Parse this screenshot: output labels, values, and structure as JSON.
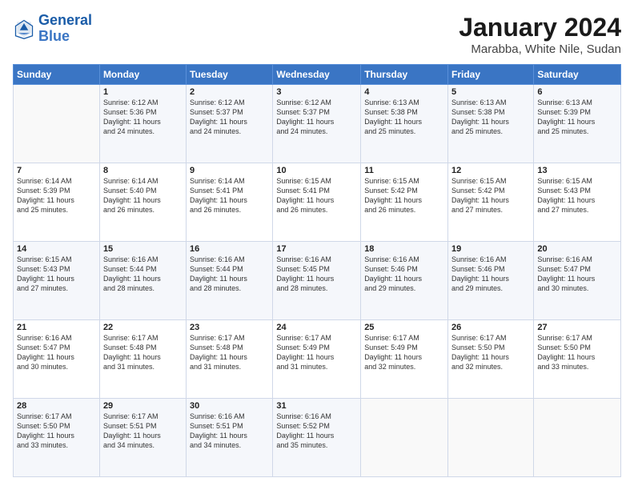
{
  "header": {
    "logo_line1": "General",
    "logo_line2": "Blue",
    "month": "January 2024",
    "location": "Marabba, White Nile, Sudan"
  },
  "weekdays": [
    "Sunday",
    "Monday",
    "Tuesday",
    "Wednesday",
    "Thursday",
    "Friday",
    "Saturday"
  ],
  "weeks": [
    [
      {
        "day": "",
        "info": ""
      },
      {
        "day": "1",
        "info": "Sunrise: 6:12 AM\nSunset: 5:36 PM\nDaylight: 11 hours\nand 24 minutes."
      },
      {
        "day": "2",
        "info": "Sunrise: 6:12 AM\nSunset: 5:37 PM\nDaylight: 11 hours\nand 24 minutes."
      },
      {
        "day": "3",
        "info": "Sunrise: 6:12 AM\nSunset: 5:37 PM\nDaylight: 11 hours\nand 24 minutes."
      },
      {
        "day": "4",
        "info": "Sunrise: 6:13 AM\nSunset: 5:38 PM\nDaylight: 11 hours\nand 25 minutes."
      },
      {
        "day": "5",
        "info": "Sunrise: 6:13 AM\nSunset: 5:38 PM\nDaylight: 11 hours\nand 25 minutes."
      },
      {
        "day": "6",
        "info": "Sunrise: 6:13 AM\nSunset: 5:39 PM\nDaylight: 11 hours\nand 25 minutes."
      }
    ],
    [
      {
        "day": "7",
        "info": "Sunrise: 6:14 AM\nSunset: 5:39 PM\nDaylight: 11 hours\nand 25 minutes."
      },
      {
        "day": "8",
        "info": "Sunrise: 6:14 AM\nSunset: 5:40 PM\nDaylight: 11 hours\nand 26 minutes."
      },
      {
        "day": "9",
        "info": "Sunrise: 6:14 AM\nSunset: 5:41 PM\nDaylight: 11 hours\nand 26 minutes."
      },
      {
        "day": "10",
        "info": "Sunrise: 6:15 AM\nSunset: 5:41 PM\nDaylight: 11 hours\nand 26 minutes."
      },
      {
        "day": "11",
        "info": "Sunrise: 6:15 AM\nSunset: 5:42 PM\nDaylight: 11 hours\nand 26 minutes."
      },
      {
        "day": "12",
        "info": "Sunrise: 6:15 AM\nSunset: 5:42 PM\nDaylight: 11 hours\nand 27 minutes."
      },
      {
        "day": "13",
        "info": "Sunrise: 6:15 AM\nSunset: 5:43 PM\nDaylight: 11 hours\nand 27 minutes."
      }
    ],
    [
      {
        "day": "14",
        "info": "Sunrise: 6:15 AM\nSunset: 5:43 PM\nDaylight: 11 hours\nand 27 minutes."
      },
      {
        "day": "15",
        "info": "Sunrise: 6:16 AM\nSunset: 5:44 PM\nDaylight: 11 hours\nand 28 minutes."
      },
      {
        "day": "16",
        "info": "Sunrise: 6:16 AM\nSunset: 5:44 PM\nDaylight: 11 hours\nand 28 minutes."
      },
      {
        "day": "17",
        "info": "Sunrise: 6:16 AM\nSunset: 5:45 PM\nDaylight: 11 hours\nand 28 minutes."
      },
      {
        "day": "18",
        "info": "Sunrise: 6:16 AM\nSunset: 5:46 PM\nDaylight: 11 hours\nand 29 minutes."
      },
      {
        "day": "19",
        "info": "Sunrise: 6:16 AM\nSunset: 5:46 PM\nDaylight: 11 hours\nand 29 minutes."
      },
      {
        "day": "20",
        "info": "Sunrise: 6:16 AM\nSunset: 5:47 PM\nDaylight: 11 hours\nand 30 minutes."
      }
    ],
    [
      {
        "day": "21",
        "info": "Sunrise: 6:16 AM\nSunset: 5:47 PM\nDaylight: 11 hours\nand 30 minutes."
      },
      {
        "day": "22",
        "info": "Sunrise: 6:17 AM\nSunset: 5:48 PM\nDaylight: 11 hours\nand 31 minutes."
      },
      {
        "day": "23",
        "info": "Sunrise: 6:17 AM\nSunset: 5:48 PM\nDaylight: 11 hours\nand 31 minutes."
      },
      {
        "day": "24",
        "info": "Sunrise: 6:17 AM\nSunset: 5:49 PM\nDaylight: 11 hours\nand 31 minutes."
      },
      {
        "day": "25",
        "info": "Sunrise: 6:17 AM\nSunset: 5:49 PM\nDaylight: 11 hours\nand 32 minutes."
      },
      {
        "day": "26",
        "info": "Sunrise: 6:17 AM\nSunset: 5:50 PM\nDaylight: 11 hours\nand 32 minutes."
      },
      {
        "day": "27",
        "info": "Sunrise: 6:17 AM\nSunset: 5:50 PM\nDaylight: 11 hours\nand 33 minutes."
      }
    ],
    [
      {
        "day": "28",
        "info": "Sunrise: 6:17 AM\nSunset: 5:50 PM\nDaylight: 11 hours\nand 33 minutes."
      },
      {
        "day": "29",
        "info": "Sunrise: 6:17 AM\nSunset: 5:51 PM\nDaylight: 11 hours\nand 34 minutes."
      },
      {
        "day": "30",
        "info": "Sunrise: 6:16 AM\nSunset: 5:51 PM\nDaylight: 11 hours\nand 34 minutes."
      },
      {
        "day": "31",
        "info": "Sunrise: 6:16 AM\nSunset: 5:52 PM\nDaylight: 11 hours\nand 35 minutes."
      },
      {
        "day": "",
        "info": ""
      },
      {
        "day": "",
        "info": ""
      },
      {
        "day": "",
        "info": ""
      }
    ]
  ]
}
